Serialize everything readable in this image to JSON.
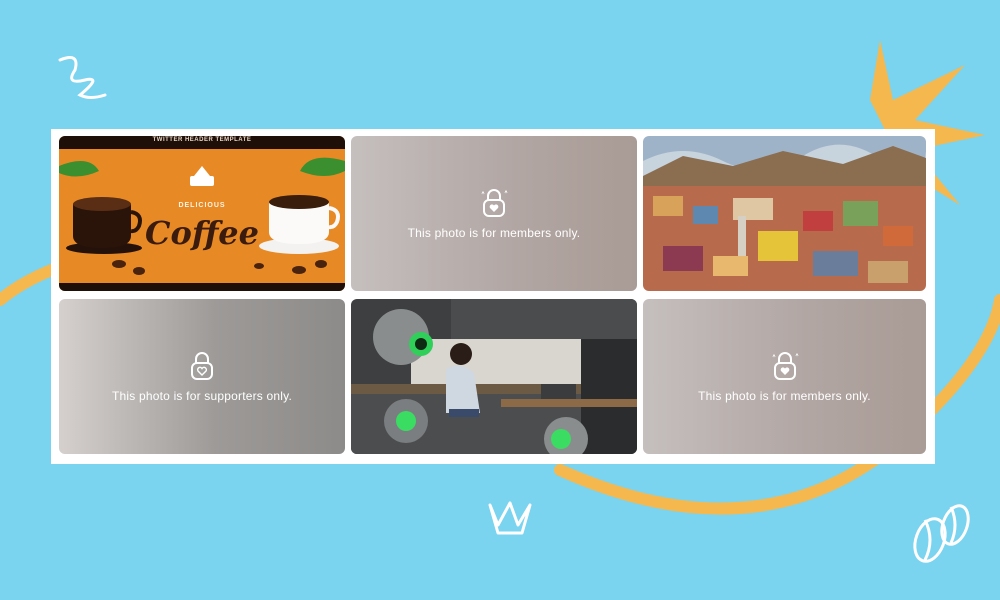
{
  "gallery": {
    "tiles": [
      {
        "kind": "image",
        "icon": "coffee-banner-image",
        "template_label": "TWITTER HEADER TEMPLATE",
        "kicker": "DELICIOUS",
        "headline": "Coffee"
      },
      {
        "kind": "locked",
        "icon": "lock-heart-icon",
        "message": "This photo is for members only."
      },
      {
        "kind": "image",
        "icon": "city-aerial-image"
      },
      {
        "kind": "locked",
        "icon": "lock-heart-icon",
        "message": "This photo is for supporters only."
      },
      {
        "kind": "image",
        "icon": "robot-kitchen-image"
      },
      {
        "kind": "locked",
        "icon": "lock-heart-icon",
        "message": "This photo is for members only."
      }
    ]
  },
  "colors": {
    "background": "#7ad3ef",
    "accent_yellow": "#f5b84f",
    "card": "#ffffff"
  }
}
